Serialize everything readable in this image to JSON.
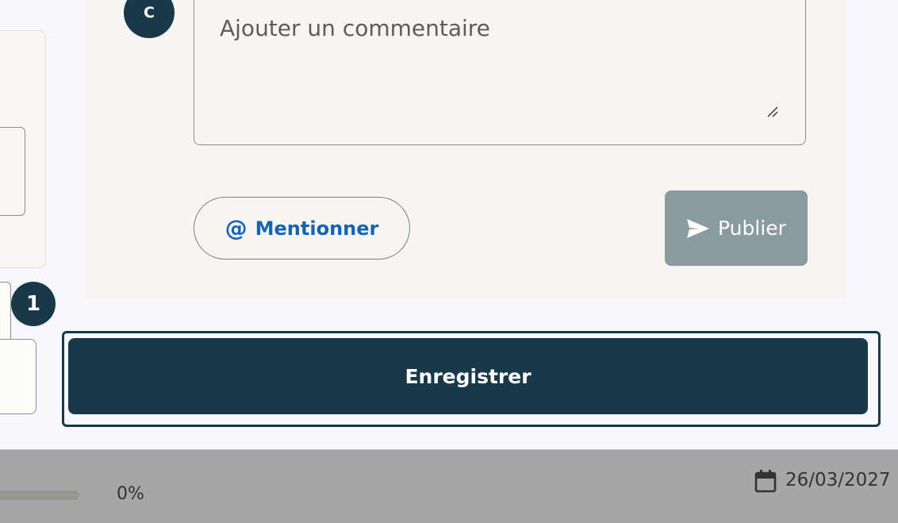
{
  "comment": {
    "avatar_initial": "C",
    "placeholder": "Ajouter un commentaire",
    "mention_label": "Mentionner",
    "publish_label": "Publier"
  },
  "step": {
    "number": "1"
  },
  "form": {
    "save_label": "Enregistrer"
  },
  "background_row": {
    "progress_label": "0%",
    "progress_fraction": 0,
    "date": "26/03/2027"
  },
  "icons": {
    "mention": "at-icon",
    "publish": "send-icon",
    "date": "calendar-icon",
    "resize": "resize-handle-icon"
  },
  "colors": {
    "primary": "#17394a",
    "link": "#1464b4",
    "disabled_button": "#8a9aa1"
  }
}
